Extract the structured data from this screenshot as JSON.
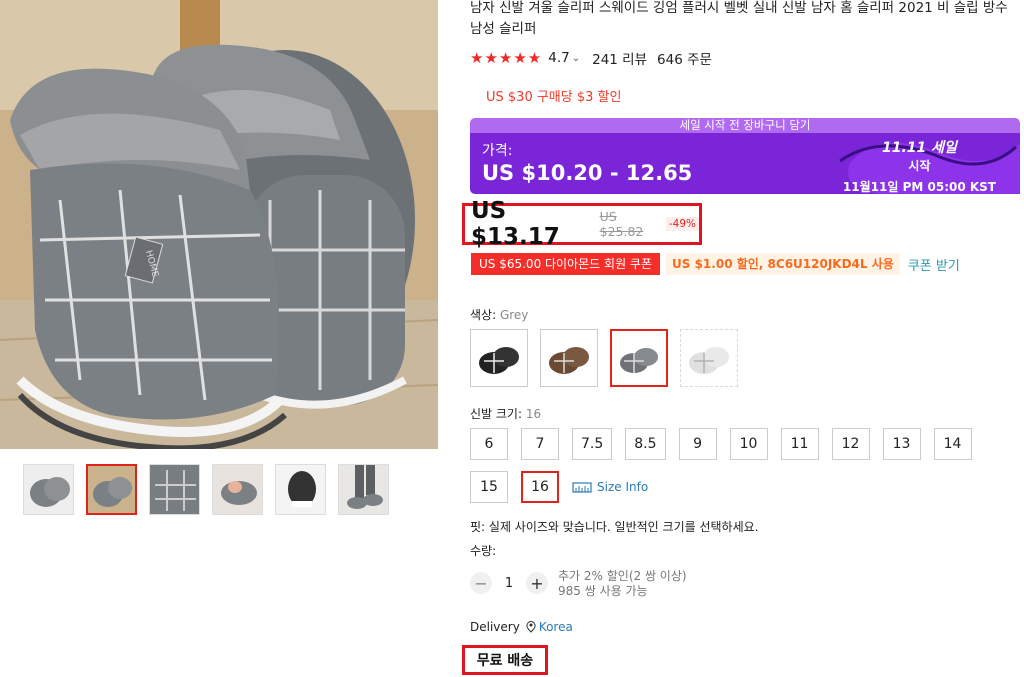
{
  "product": {
    "title": "남자 신발 겨울 슬리퍼 스웨이드 깅엄 플러시 벨벳 실내 신발 남자 홈 슬리퍼 2021 비 슬립 방수 남성 슬리퍼",
    "rating": "4.7",
    "reviews": "241 리뷰",
    "orders": "646 주문",
    "promo": "US $30 구매당 $3 할인"
  },
  "gallery": {
    "thumbnails": [
      "thumb-1",
      "thumb-2",
      "thumb-3",
      "thumb-4",
      "thumb-5",
      "thumb-6"
    ],
    "active_index": 1,
    "main_logo_text": "HOME"
  },
  "sale_banner": {
    "top_text": "세일 시작 전 장바구니 담기",
    "price_label": "가격:",
    "price_range": "US $10.20 - 12.65",
    "event_line1": "11.11 세일",
    "event_line2": "시작",
    "event_line3": "11월11일 PM 05:00 KST"
  },
  "price": {
    "current": "US $13.17",
    "original": "US $25.82",
    "discount": "-49%"
  },
  "coupons": {
    "member": "US $65.00 다이아몬드 회원 쿠폰",
    "code": "US $1.00 할인, 8C6U120JKD4L 사용",
    "get": "쿠폰 받기"
  },
  "color": {
    "label": "색상:",
    "value": "Grey",
    "options": [
      "black",
      "brown",
      "grey",
      "white"
    ],
    "selected_index": 2
  },
  "size": {
    "label": "신발 크기:",
    "value": "16",
    "options": [
      "6",
      "7",
      "7.5",
      "8.5",
      "9",
      "10",
      "11",
      "12",
      "13",
      "14",
      "15",
      "16"
    ],
    "selected": "16",
    "info_link": "Size Info"
  },
  "fit_note": "핏: 실제 사이즈와 맞습니다. 일반적인 크기를 선택하세요.",
  "quantity": {
    "label": "수량:",
    "value": "1",
    "note1": "추가 2% 할인(2 쌍 이상)",
    "note2": "985 쌍 사용 가능"
  },
  "delivery": {
    "label": "Delivery",
    "destination": "Korea",
    "free_shipping": "무료 배송"
  },
  "colors": {
    "accent_red": "#e2141f",
    "star_red": "#ee2a24",
    "banner_purple": "#7a25d8",
    "link_blue": "#2a7ab5"
  }
}
